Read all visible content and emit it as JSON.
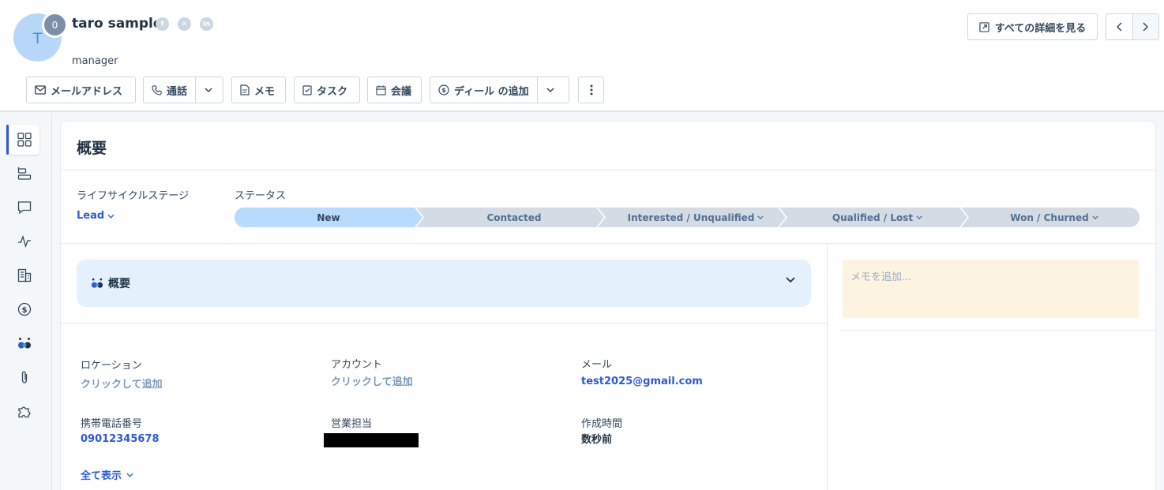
{
  "contact": {
    "initial": "T",
    "badge_count": "0",
    "name": "taro sample",
    "job_title": "manager",
    "socials": [
      "facebook-icon",
      "x-icon",
      "linkedin-icon"
    ]
  },
  "toolbar": {
    "email": "メールアドレス",
    "call": "通話",
    "note": "メモ",
    "task": "タスク",
    "meeting": "会議",
    "add_deal": "ディール の追加"
  },
  "header_right": {
    "view_all": "すべての詳細を見る"
  },
  "sidebar": {
    "items": [
      "overview-grid-icon",
      "timeline-icon",
      "chat-icon",
      "activity-icon",
      "company-icon",
      "deal-dollar-icon",
      "ai-agent-icon",
      "attachment-icon",
      "puzzle-icon"
    ],
    "active_index": 0
  },
  "card": {
    "title": "概要",
    "lifecycle_label": "ライフサイクルステージ",
    "lifecycle_value": "Lead",
    "status_label": "ステータス",
    "stages": [
      {
        "label": "New",
        "active": true,
        "dropdown": false
      },
      {
        "label": "Contacted",
        "active": false,
        "dropdown": false
      },
      {
        "label": "Interested / Unqualified",
        "active": false,
        "dropdown": true
      },
      {
        "label": "Qualified / Lost",
        "active": false,
        "dropdown": true
      },
      {
        "label": "Won / Churned",
        "active": false,
        "dropdown": true
      }
    ],
    "accordion_title": "概要",
    "properties": {
      "location_label": "ロケーション",
      "location_value": "クリックして追加",
      "account_label": "アカウント",
      "account_value": "クリックして追加",
      "email_label": "メール",
      "email_value": "test2025@gmail.com",
      "mobile_label": "携帯電話番号",
      "mobile_value": "09012345678",
      "owner_label": "営業担当",
      "created_label": "作成時間",
      "created_value": "数秒前"
    },
    "show_all": "全て表示",
    "note_placeholder": "メモを追加..."
  },
  "colors": {
    "accent": "#2d5bd1",
    "stage_active": "#b8dafc",
    "stage_inactive": "#d5dbe4",
    "note_bg": "#fdf3e1",
    "accordion_bg": "#e5f0fd"
  }
}
